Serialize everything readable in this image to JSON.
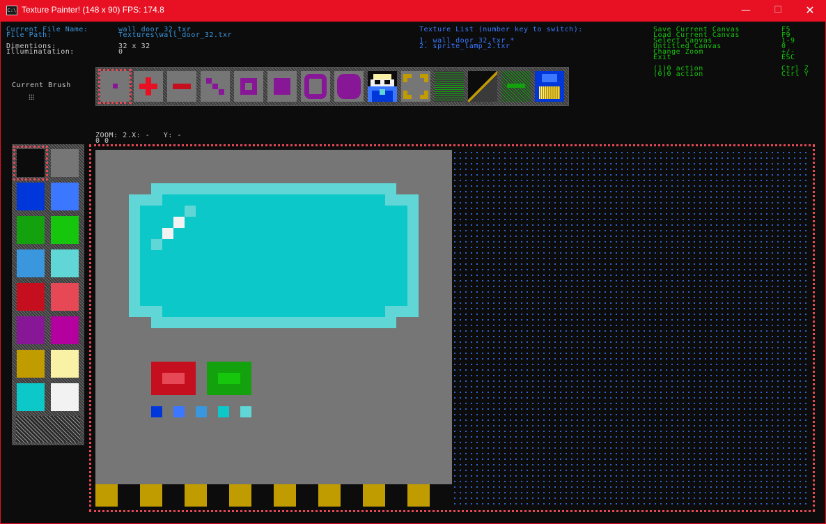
{
  "window": {
    "title": "Texture Painter! (148 x 90) FPS: 174.8",
    "app_icon_text": "C:\\",
    "minimize": "—",
    "maximize": "☐",
    "close": "✕"
  },
  "info": {
    "file_name_label": "Current File Name:",
    "file_name_value": "wall_door_32.txr",
    "file_path_label": "File Path:",
    "file_path_value": "Textures\\wall_door_32.txr",
    "dimensions_label": "Dimentions:",
    "dimensions_value": "32 x 32",
    "illumination_label": "Illuminatation:",
    "illumination_value": "0"
  },
  "texture_list": {
    "heading": "Texture List (number key to switch):",
    "items": [
      "1. wall_door_32.txr *",
      "2. sprite_lamp_2.txr"
    ]
  },
  "shortcuts": [
    {
      "label": "Save Current Canvas",
      "key": "F5"
    },
    {
      "label": "Load Current Canvas",
      "key": "F9"
    },
    {
      "label": "Select Canvas",
      "key": "1-9"
    },
    {
      "label": "Untitled Canvas",
      "key": "0"
    },
    {
      "label": "Change Zoom",
      "key": "+/-"
    },
    {
      "label": "Exit",
      "key": "ESC"
    },
    {
      "label": "(1)0 action",
      "key": "Ctrl Z"
    },
    {
      "label": "(0)0 action",
      "key": "Ctrl Y"
    }
  ],
  "brush": {
    "label": "Current Brush"
  },
  "status": {
    "zoom_line": "ZOOM: 2.X: -   Y: -",
    "zoom_line2": "0 0"
  },
  "tools": [
    "pixel-tool-icon",
    "plus-brush-icon",
    "minus-brush-icon",
    "line-tool-icon",
    "hollow-square-icon",
    "filled-square-icon",
    "hollow-circle-icon",
    "filled-circle-icon",
    "sprite-preview-icon",
    "dotted-rect-icon",
    "pattern-icon",
    "gradient-icon",
    "arrow-icon",
    "save-disk-icon"
  ],
  "palette": {
    "colors": [
      "#0c0c0c",
      "#767676",
      "#0037da",
      "#3b78ff",
      "#13a10e",
      "#16c60c",
      "#3a96dd",
      "#61d6d6",
      "#c50f1f",
      "#e74856",
      "#881798",
      "#b4009e",
      "#c19c00",
      "#f9f1a5",
      "#0cc8c8",
      "#f2f2f2"
    ],
    "selected_index": 0
  }
}
